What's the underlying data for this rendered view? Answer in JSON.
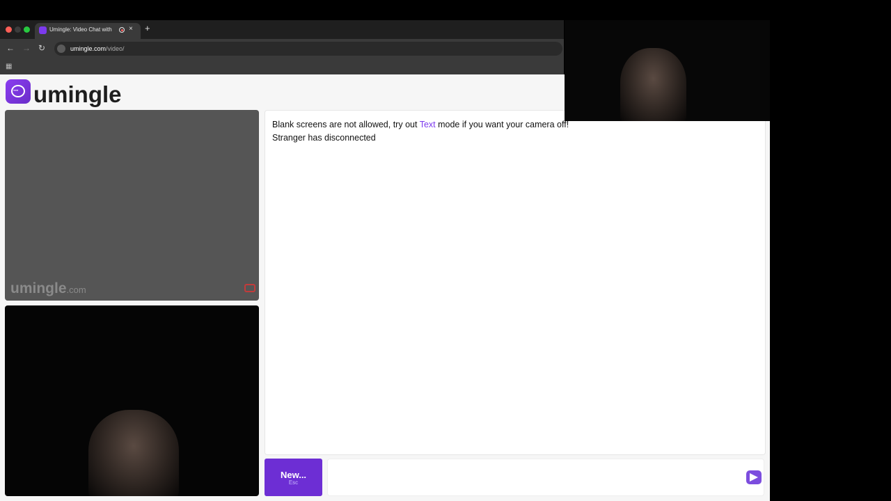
{
  "browser": {
    "tab_title": "Umingle: Video Chat with",
    "tab_close": "×",
    "new_tab": "+",
    "url_domain": "umingle.com",
    "url_path": "/video/",
    "nav": {
      "back": "←",
      "forward": "→",
      "reload": "↻"
    },
    "apps_icon": "▦"
  },
  "colors": {
    "brand": "#7c3aed",
    "new_button": "#6d2ed4",
    "report": "#c23b3b",
    "traffic": [
      "#ff5f57",
      "#3c3c3c",
      "#28c840"
    ]
  },
  "header": {
    "logo_text": "umingle",
    "logo_dots": "···"
  },
  "stranger_video": {
    "watermark": "umingle",
    "watermark_tld": ".com"
  },
  "chat": {
    "message1_before": "Blank screens are not allowed, try out ",
    "message1_link": "Text",
    "message1_after": " mode if you want your camera off!",
    "message2": "Stranger has disconnected"
  },
  "controls": {
    "new_label": "New...",
    "new_hint": "Esc",
    "input_value": "",
    "input_placeholder": ""
  }
}
